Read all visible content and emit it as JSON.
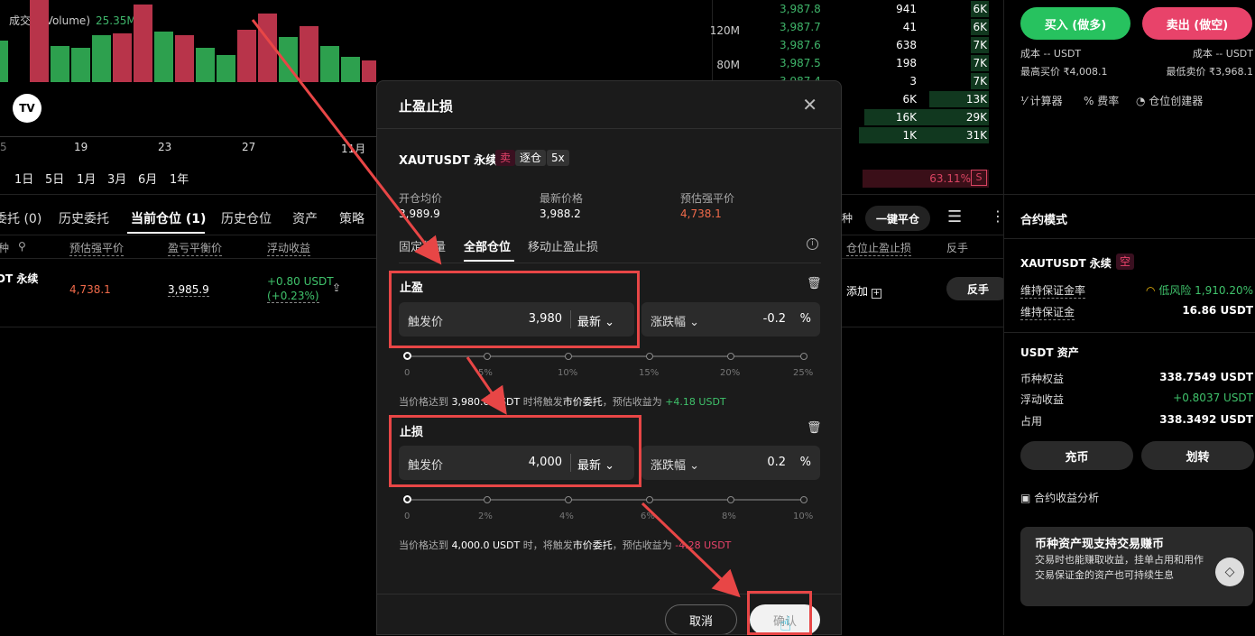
{
  "chart": {
    "volume_label": "成交量(Volume)",
    "volume_value": "25.35M",
    "y_ticks": [
      "120M",
      "80M"
    ],
    "x_ticks": [
      "19",
      "23",
      "27",
      "11月"
    ],
    "x_partial": "5",
    "timeframes": [
      "1日",
      "5日",
      "1月",
      "3月",
      "6月",
      "1年"
    ],
    "logo": "TV"
  },
  "orderbook": {
    "rows": [
      {
        "price": "3,987.8",
        "amount": "941",
        "total": "6K"
      },
      {
        "price": "3,987.7",
        "amount": "41",
        "total": "6K"
      },
      {
        "price": "3,987.6",
        "amount": "638",
        "total": "7K"
      },
      {
        "price": "3,987.5",
        "amount": "198",
        "total": "7K"
      },
      {
        "price": "3,987.4",
        "amount": "3",
        "total": "7K"
      },
      {
        "price": "",
        "amount": "6K",
        "total": "13K"
      },
      {
        "price": "",
        "amount": "16K",
        "total": "29K"
      },
      {
        "price": "",
        "amount": "1K",
        "total": "31K"
      }
    ],
    "ratio": "63.11%",
    "side_badge": "S"
  },
  "positions": {
    "tabs": [
      "委托 (0)",
      "历史委托",
      "当前仓位 (1)",
      "历史仓位",
      "资产",
      "策略"
    ],
    "active_tab": "当前仓位 (1)",
    "headers": [
      "种",
      "预估强平价",
      "盈亏平衡价",
      "浮动收益"
    ],
    "right_headers": [
      "种",
      "仓位止盈止损",
      "反手"
    ],
    "one_click_close": "一键平仓",
    "row": {
      "symbol": "DT 永续",
      "liq_price": "4,738.1",
      "breakeven": "3,985.9",
      "pnl": "+0.80 USDT",
      "pnl_pct": "(+0.23%)",
      "add_label": "添加",
      "reverse_label": "反手"
    }
  },
  "right_panel": {
    "buy_label": "买入 (做多)",
    "sell_label": "卖出 (做空)",
    "cost_left": "成本 -- USDT",
    "cost_right": "成本 -- USDT",
    "max_buy": "最高买价 ₹4,008.1",
    "min_sell": "最低卖价 ₹3,968.1",
    "tools": [
      "计算器",
      "费率",
      "仓位创建器"
    ],
    "contract_mode_title": "合约模式",
    "symbol": "XAUTUSDT 永续",
    "short_badge": "空",
    "maint_margin_rate_label": "维持保证金率",
    "maint_margin_rate_value": "低风险 1,910.20%",
    "maint_margin_label": "维持保证金",
    "maint_margin_value": "16.86 USDT",
    "usdt_assets_title": "USDT 资产",
    "equity_label": "币种权益",
    "equity_value": "338.7549 USDT",
    "float_pnl_label": "浮动收益",
    "float_pnl_value": "+0.8037 USDT",
    "used_label": "占用",
    "used_value": "338.3492 USDT",
    "deposit_label": "充币",
    "transfer_label": "划转",
    "analysis_label": "合约收益分析",
    "promo_title": "币种资产现支持交易赚币",
    "promo_text": "交易时也能赚取收益，挂单占用和用作交易保证金的资产也可持续生息"
  },
  "dialog": {
    "title": "止盈止损",
    "symbol": "XAUTUSDT 永续",
    "side_badge": "卖",
    "margin_badge": "逐仓",
    "leverage_badge": "5x",
    "open_price_label": "开仓均价",
    "open_price_value": "3,989.9",
    "last_price_label": "最新价格",
    "last_price_value": "3,988.2",
    "liq_price_label": "预估强平价",
    "liq_price_value": "4,738.1",
    "tabs": [
      "固定数量",
      "全部仓位",
      "移动止盈止损"
    ],
    "active_tab": "全部仓位",
    "tp": {
      "title": "止盈",
      "trigger_label": "触发价",
      "trigger_value": "3,980",
      "price_type": "最新",
      "change_label": "涨跌幅",
      "change_value": "-0.2",
      "unit": "%",
      "ticks": [
        "0",
        "5%",
        "10%",
        "15%",
        "20%",
        "25%"
      ],
      "hint_prefix": "当价格达到",
      "hint_price": "3,980.0 USDT",
      "hint_mid": "时将触发",
      "hint_order": "市价委托",
      "hint_pnl_label": "，预估收益为",
      "hint_pnl": "+4.18 USDT"
    },
    "sl": {
      "title": "止损",
      "trigger_label": "触发价",
      "trigger_value": "4,000",
      "price_type": "最新",
      "change_label": "涨跌幅",
      "change_value": "0.2",
      "unit": "%",
      "ticks": [
        "0",
        "2%",
        "4%",
        "6%",
        "8%",
        "10%"
      ],
      "hint_prefix": "当价格达到",
      "hint_price": "4,000.0 USDT",
      "hint_mid": "时，将触发",
      "hint_order": "市价委托",
      "hint_pnl_label": "，预估收益为",
      "hint_pnl": "-4.28 USDT"
    },
    "cancel_label": "取消",
    "confirm_label": "确认"
  },
  "colors": {
    "buy": "#27c25f",
    "sell": "#e8436a",
    "annotation": "#e84646"
  }
}
